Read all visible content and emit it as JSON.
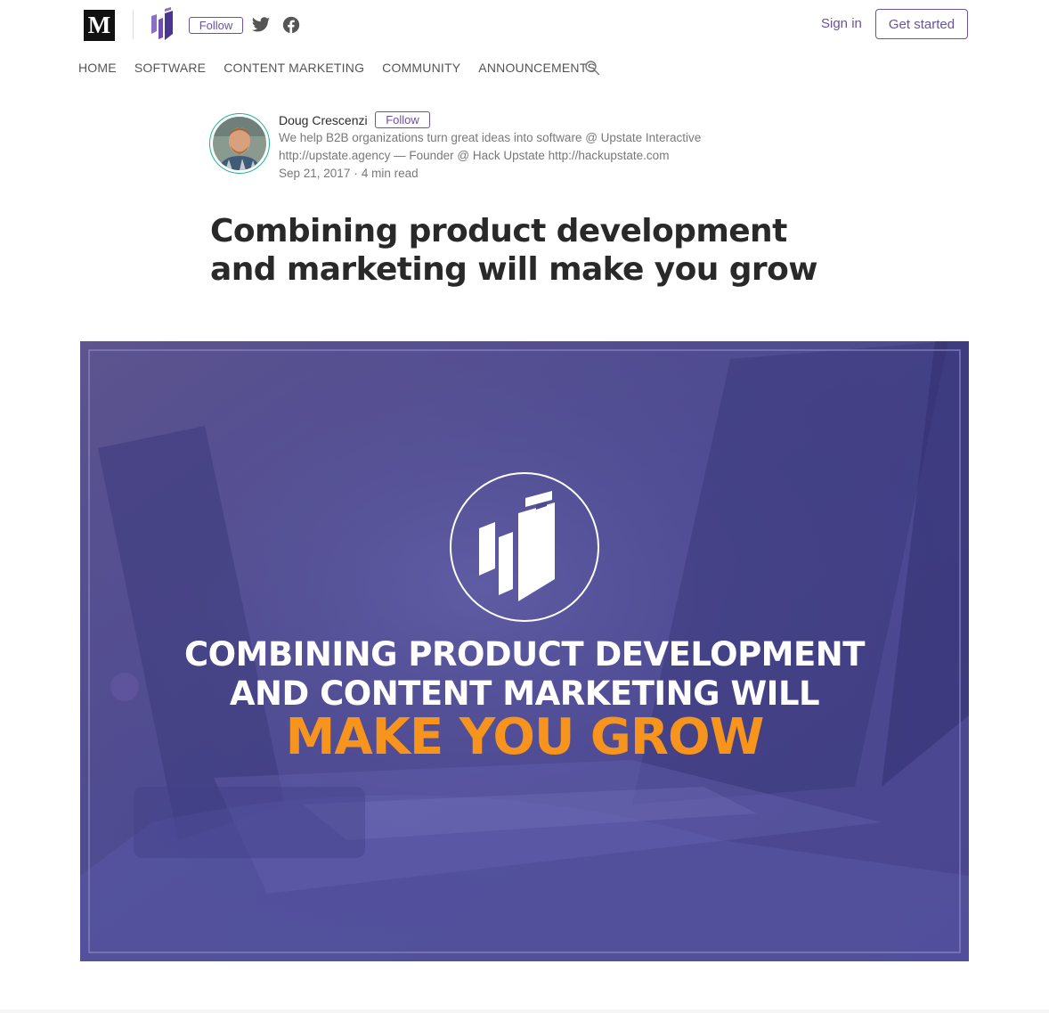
{
  "topbar": {
    "medium_logo_letter": "M",
    "publication_logo_icon": "upstate-interactive-logo",
    "follow_label": "Follow",
    "social_icons": [
      "twitter-icon",
      "facebook-icon"
    ],
    "signin_label": "Sign in",
    "get_started_label": "Get started",
    "accent_color": "#6a52a1"
  },
  "nav": {
    "items": [
      {
        "label": "HOME"
      },
      {
        "label": "SOFTWARE"
      },
      {
        "label": "CONTENT MARKETING"
      },
      {
        "label": "COMMUNITY"
      },
      {
        "label": "ANNOUNCEMENTS"
      }
    ],
    "search_icon": "search-icon"
  },
  "author": {
    "name": "Doug Crescenzi",
    "follow_label": "Follow",
    "bio_line1": "We help B2B organizations turn great ideas into software @ Upstate Interactive",
    "bio_line2": "http://upstate.agency — Founder @ Hack Upstate http://hackupstate.com",
    "date": "Sep 21, 2017",
    "separator": "·",
    "read_time": "4 min read",
    "avatar_ring_color": "#1ab394"
  },
  "article": {
    "title": "Combining product development and marketing will make you grow"
  },
  "hero": {
    "line1": "COMBINING PRODUCT DEVELOPMENT",
    "line2": "AND CONTENT MARKETING WILL",
    "line3": "MAKE YOU GROW",
    "highlight_color": "#f7941d",
    "overlay_color": "#5a4f9a"
  }
}
